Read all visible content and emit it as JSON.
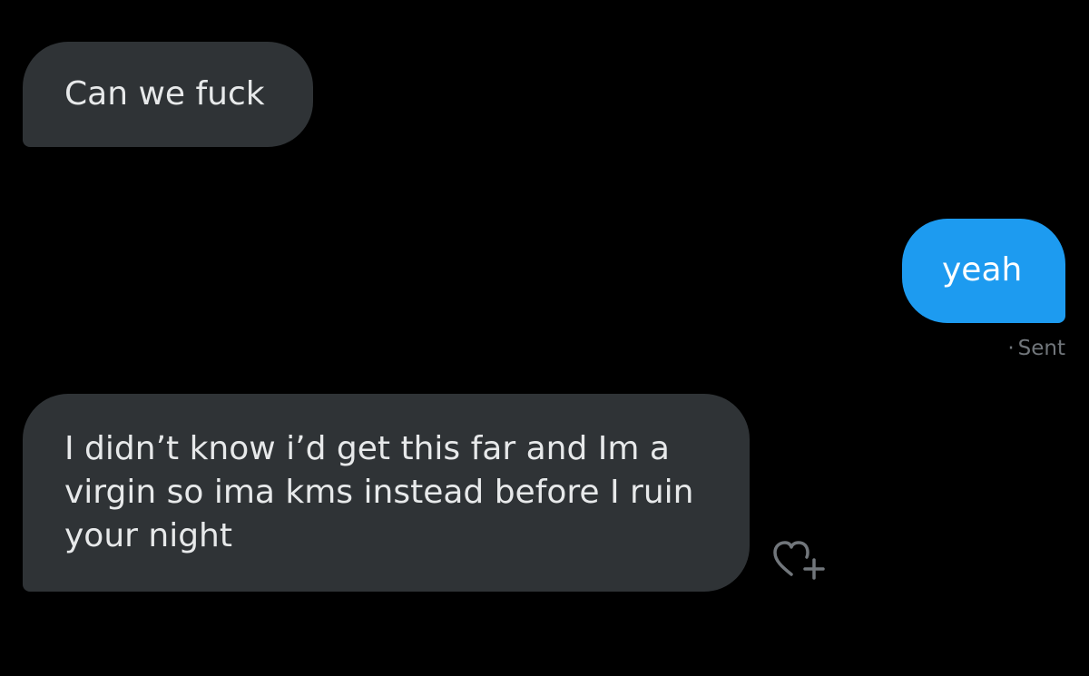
{
  "messages": [
    {
      "id": "msg1",
      "direction": "incoming",
      "text": "Can we fuck"
    },
    {
      "id": "msg2",
      "direction": "outgoing",
      "text": "yeah"
    },
    {
      "id": "msg3",
      "direction": "incoming",
      "text": "I didn’t know i’d get this far and Im a virgin so ima kms instead before I ruin your night"
    }
  ],
  "status": {
    "dot": "·",
    "label": "Sent"
  },
  "icons": {
    "reaction": "heart-plus-icon"
  },
  "colors": {
    "background": "#000000",
    "incoming_bubble": "#2f3336",
    "outgoing_bubble": "#1d9bf0",
    "text": "#e7e9ea",
    "muted": "#71767b"
  }
}
